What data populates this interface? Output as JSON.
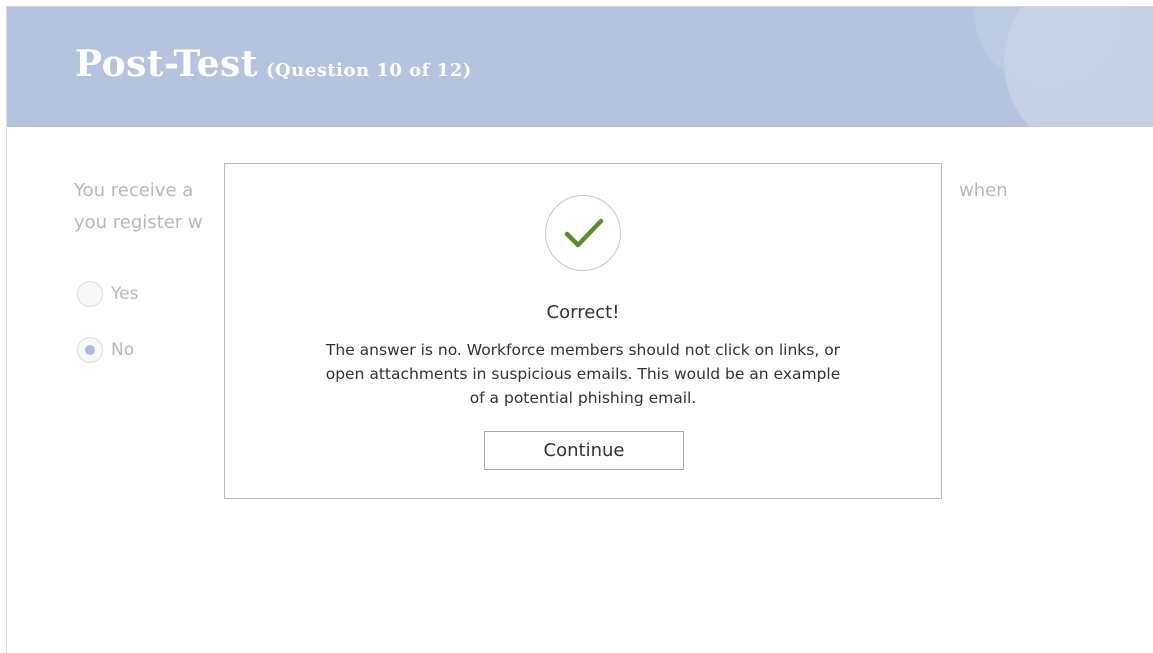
{
  "header": {
    "title": "Post-Test",
    "subtitle": "(Question 10 of 12)"
  },
  "question": {
    "text_left_line1": "You receive a",
    "text_right_line1": "when",
    "text_left_line2": "you register w"
  },
  "options": [
    {
      "label": "Yes",
      "selected": false
    },
    {
      "label": "No",
      "selected": true
    }
  ],
  "feedback": {
    "icon": "checkmark-icon",
    "title": "Correct!",
    "lines": [
      "The answer is no. Workforce members should not click on links, or",
      "open attachments in suspicious emails. This would be an example",
      "of a potential phishing email."
    ],
    "continue_label": "Continue"
  },
  "colors": {
    "header_band": "#b5c4de",
    "checkmark": "#5d8a2e",
    "radio_selected": "#a9bde0"
  }
}
